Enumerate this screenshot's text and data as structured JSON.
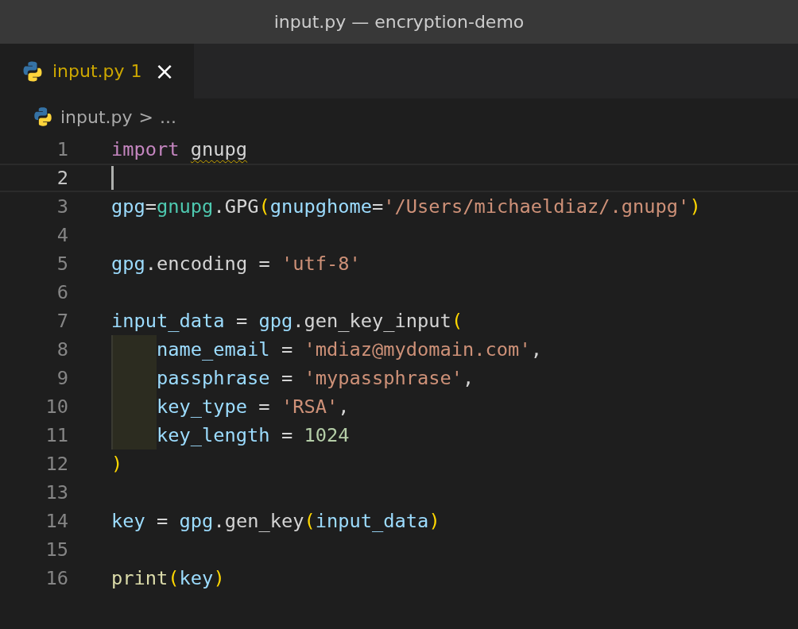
{
  "window": {
    "title": "input.py — encryption-demo"
  },
  "tabs": [
    {
      "label": "input.py",
      "problems": "1",
      "close": "×",
      "selected": true
    }
  ],
  "breadcrumb": {
    "file": "input.py",
    "separator": ">",
    "more": "..."
  },
  "editor": {
    "lines": [
      {
        "number": "1",
        "selected": false,
        "indent_highlight": false,
        "tokens": [
          {
            "text": "import ",
            "kind": "keyword"
          },
          {
            "text": "gnupg",
            "kind": "plain",
            "warning": true
          }
        ]
      },
      {
        "number": "2",
        "selected": true,
        "indent_highlight": false
      },
      {
        "number": "3",
        "selected": false,
        "indent_highlight": false,
        "tokens": [
          {
            "text": "gpg",
            "kind": "variable"
          },
          {
            "text": "=",
            "kind": "plain"
          },
          {
            "text": "gnupg",
            "kind": "module"
          },
          {
            "text": ".GPG",
            "kind": "plain"
          },
          {
            "text": "(",
            "kind": "paren"
          },
          {
            "text": "gnupghome",
            "kind": "variable"
          },
          {
            "text": "=",
            "kind": "plain"
          },
          {
            "text": "'/Users/michaeldiaz/.gnupg'",
            "kind": "string"
          },
          {
            "text": ")",
            "kind": "paren"
          }
        ]
      },
      {
        "number": "4",
        "selected": false,
        "indent_highlight": false
      },
      {
        "number": "5",
        "selected": false,
        "indent_highlight": false,
        "tokens": [
          {
            "text": "gpg",
            "kind": "variable"
          },
          {
            "text": ".encoding = ",
            "kind": "plain"
          },
          {
            "text": "'utf-8'",
            "kind": "string"
          }
        ]
      },
      {
        "number": "6",
        "selected": false,
        "indent_highlight": false
      },
      {
        "number": "7",
        "selected": false,
        "indent_highlight": false,
        "tokens": [
          {
            "text": "input_data",
            "kind": "variable"
          },
          {
            "text": " = ",
            "kind": "plain"
          },
          {
            "text": "gpg",
            "kind": "variable"
          },
          {
            "text": ".gen_key_input",
            "kind": "plain"
          },
          {
            "text": "(",
            "kind": "paren"
          }
        ]
      },
      {
        "number": "8",
        "selected": false,
        "indent_highlight": true,
        "tokens": [
          {
            "text": "name_email",
            "kind": "variable"
          },
          {
            "text": " = ",
            "kind": "plain"
          },
          {
            "text": "'mdiaz@mydomain.com'",
            "kind": "string"
          },
          {
            "text": ",",
            "kind": "plain"
          }
        ]
      },
      {
        "number": "9",
        "selected": false,
        "indent_highlight": true,
        "tokens": [
          {
            "text": "passphrase",
            "kind": "variable"
          },
          {
            "text": " = ",
            "kind": "plain"
          },
          {
            "text": "'mypassphrase'",
            "kind": "string"
          },
          {
            "text": ",",
            "kind": "plain"
          }
        ]
      },
      {
        "number": "10",
        "selected": false,
        "indent_highlight": true,
        "tokens": [
          {
            "text": "key_type",
            "kind": "variable"
          },
          {
            "text": " = ",
            "kind": "plain"
          },
          {
            "text": "'RSA'",
            "kind": "string"
          },
          {
            "text": ",",
            "kind": "plain"
          }
        ]
      },
      {
        "number": "11",
        "selected": false,
        "indent_highlight": true,
        "tokens": [
          {
            "text": "key_length",
            "kind": "variable"
          },
          {
            "text": " = ",
            "kind": "plain"
          },
          {
            "text": "1024",
            "kind": "number"
          }
        ]
      },
      {
        "number": "12",
        "selected": false,
        "indent_highlight": false,
        "tokens": [
          {
            "text": ")",
            "kind": "paren"
          }
        ]
      },
      {
        "number": "13",
        "selected": false,
        "indent_highlight": false
      },
      {
        "number": "14",
        "selected": false,
        "indent_highlight": false,
        "tokens": [
          {
            "text": "key",
            "kind": "variable"
          },
          {
            "text": " = ",
            "kind": "plain"
          },
          {
            "text": "gpg",
            "kind": "variable"
          },
          {
            "text": ".gen_key",
            "kind": "plain"
          },
          {
            "text": "(",
            "kind": "paren"
          },
          {
            "text": "input_data",
            "kind": "variable"
          },
          {
            "text": ")",
            "kind": "paren"
          }
        ]
      },
      {
        "number": "15",
        "selected": false,
        "indent_highlight": false
      },
      {
        "number": "16",
        "selected": false,
        "indent_highlight": false,
        "tokens": [
          {
            "text": "print",
            "kind": "func"
          },
          {
            "text": "(",
            "kind": "paren"
          },
          {
            "text": "key",
            "kind": "variable"
          },
          {
            "text": ")",
            "kind": "paren"
          }
        ]
      }
    ]
  }
}
